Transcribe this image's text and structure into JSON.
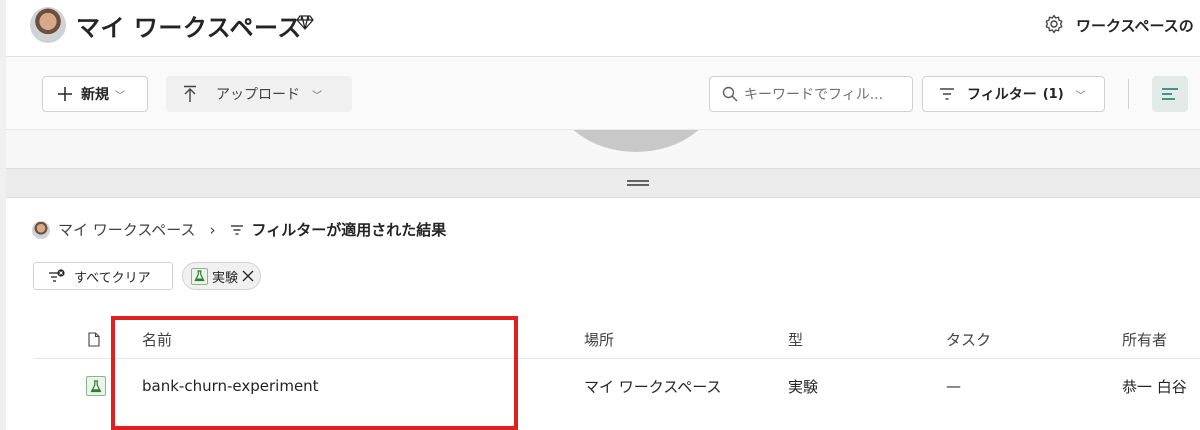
{
  "header": {
    "title": "マイ ワークスペース",
    "settings_label": "ワークスペースの"
  },
  "toolbar": {
    "new_label": "新規",
    "upload_label": "アップロード",
    "search_placeholder": "キーワードでフィル...",
    "filter_label": "フィルター",
    "filter_count": "(1)"
  },
  "breadcrumb": {
    "workspace": "マイ ワークスペース",
    "result": "フィルターが適用された結果"
  },
  "chips": {
    "clear_all": "すべてクリア",
    "tag": "実験"
  },
  "table": {
    "columns": {
      "name": "名前",
      "location": "場所",
      "type": "型",
      "task": "タスク",
      "owner": "所有者"
    },
    "rows": [
      {
        "name": "bank-churn-experiment",
        "location": "マイ ワークスペース",
        "type": "実験",
        "task": "—",
        "owner": "恭一 白谷"
      }
    ]
  },
  "colors": {
    "accent": "#e02020",
    "flask_green": "#2e7d32",
    "view_button_bg": "#e3ebe8"
  }
}
